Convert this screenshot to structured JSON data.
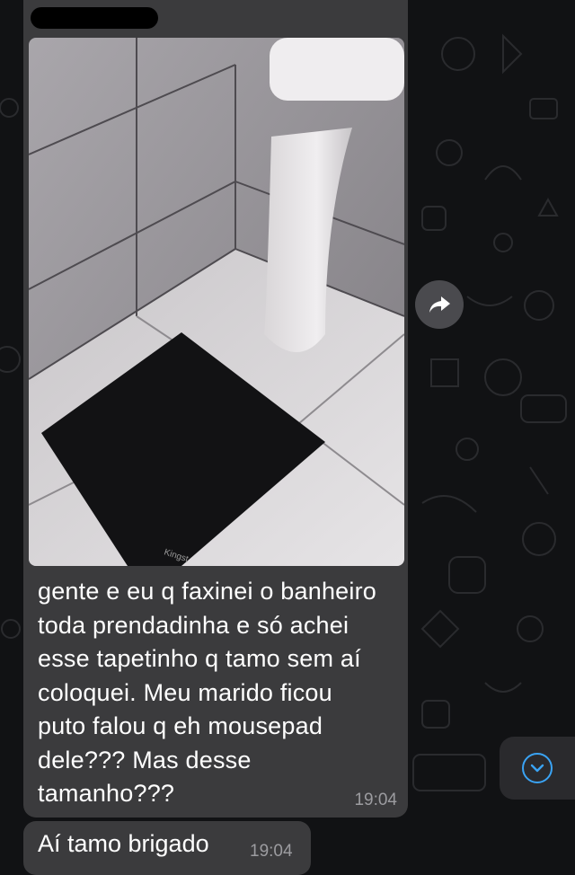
{
  "chat": {
    "message_main": {
      "text": "gente e eu q faxinei o banheiro\ntoda prendadinha e só achei\nesse tapetinho q tamo sem aí\ncoloquei. Meu marido ficou\nputo falou q eh mousepad\ndele??? Mas desse\ntamanho???",
      "time": "19:04",
      "image_alt": "bathroom-floor-mousepad-photo"
    },
    "message_second": {
      "text": "Aí tamo brigado",
      "time": "19:04"
    },
    "icons": {
      "forward": "forward-arrow-icon",
      "scroll_down": "chevron-down-icon"
    },
    "colors": {
      "bubble": "#3b3b3d",
      "background": "#111214",
      "accent": "#3aa3f4"
    }
  }
}
